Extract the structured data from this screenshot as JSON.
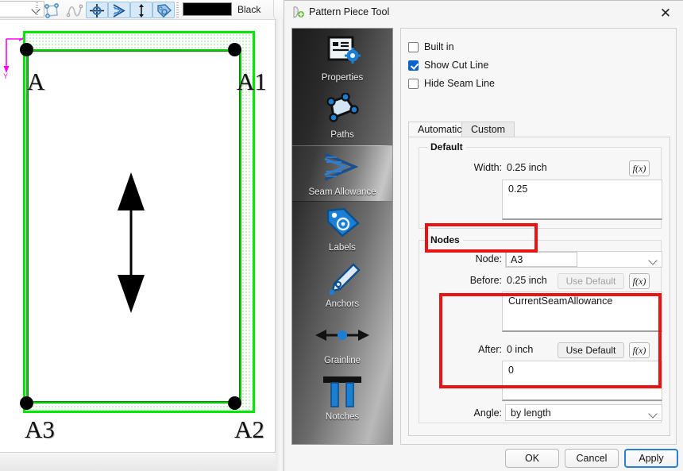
{
  "toolbar": {
    "combo_value": "",
    "buttons": [
      {
        "name": "add-pattern-piece-icon",
        "active": false
      },
      {
        "name": "curve-tool-icon",
        "active": false
      },
      {
        "name": "anchor-point-icon",
        "active": true
      },
      {
        "name": "seam-allowance-icon",
        "active": true
      },
      {
        "name": "grainline-icon",
        "active": true
      },
      {
        "name": "label-tag-icon",
        "active": true
      }
    ],
    "color_swatch": "#000000",
    "color_label": "Black"
  },
  "canvas": {
    "axis_label": "Y",
    "axis_color": "#ff00ff",
    "seam_color": "#00e800",
    "cut_line_color": "#00cc00",
    "nodes": [
      {
        "label": "A",
        "pos": "top-left"
      },
      {
        "label": "A1",
        "pos": "top-right"
      },
      {
        "label": "A3",
        "pos": "bottom-left"
      },
      {
        "label": "A2",
        "pos": "bottom-right"
      }
    ],
    "grainline_name": "grainline-arrow"
  },
  "dialog": {
    "title": "Pattern Piece Tool",
    "close_label": "✕",
    "sidebar": [
      {
        "label": "Properties",
        "icon": "properties-icon",
        "selected": false
      },
      {
        "label": "Paths",
        "icon": "paths-icon",
        "selected": false
      },
      {
        "label": "Seam Allowance",
        "icon": "seam-allowance-icon",
        "selected": true
      },
      {
        "label": "Labels",
        "icon": "labels-icon",
        "selected": false
      },
      {
        "label": "Anchors",
        "icon": "anchors-icon",
        "selected": false
      },
      {
        "label": "Grainline",
        "icon": "grainline-icon",
        "selected": false
      },
      {
        "label": "Notches",
        "icon": "notches-icon",
        "selected": false
      }
    ],
    "checkboxes": [
      {
        "label": "Built in",
        "checked": false
      },
      {
        "label": "Show Cut Line",
        "checked": true
      },
      {
        "label": "Hide Seam Line",
        "checked": false
      }
    ],
    "tabs": [
      {
        "label": "Automatic",
        "active": true
      },
      {
        "label": "Custom",
        "active": false
      }
    ],
    "default_group": {
      "title": "Default",
      "width_label": "Width:",
      "width_value": "0.25 inch",
      "width_formula": "0.25",
      "fx_label": "f(x)"
    },
    "nodes_group": {
      "title": "Nodes",
      "node_label": "Node:",
      "node_value": "A3",
      "before_label": "Before:",
      "before_value": "0.25 inch",
      "before_formula": "CurrentSeamAllowance",
      "before_use_default": "Use Default",
      "after_label": "After:",
      "after_value": "0 inch",
      "after_formula": "0",
      "after_use_default": "Use Default",
      "angle_label": "Angle:",
      "angle_value": "by length",
      "fx_label": "f(x)"
    },
    "footer": {
      "ok": "OK",
      "cancel": "Cancel",
      "apply": "Apply"
    }
  },
  "annotations": {
    "highlight_color": "#e81414",
    "boxes": [
      {
        "name": "node-selector-highlight"
      },
      {
        "name": "after-section-highlight"
      }
    ]
  }
}
